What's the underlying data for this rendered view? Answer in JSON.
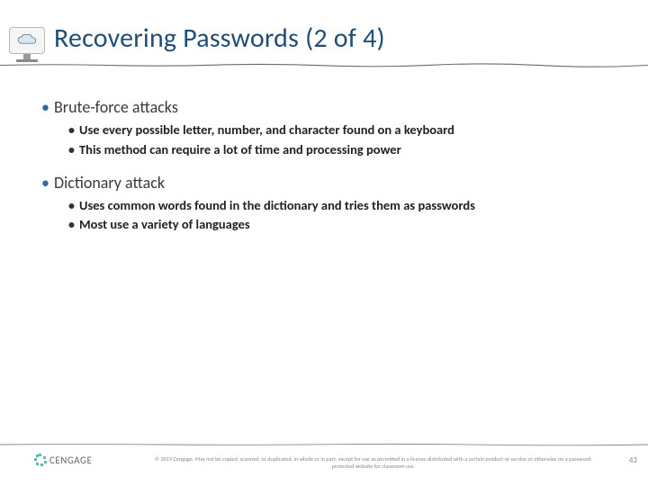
{
  "header": {
    "title": "Recovering Passwords (2 of 4)"
  },
  "bullets": [
    {
      "text": "Brute-force attacks",
      "subs": [
        "Use every possible letter, number, and character found on a keyboard",
        "This method can require a lot of time and processing power"
      ]
    },
    {
      "text": "Dictionary attack",
      "subs": [
        "Uses common words found in the dictionary and tries them as passwords",
        "Most use a variety of languages"
      ]
    }
  ],
  "footer": {
    "brand": "CENGAGE",
    "copyright": "© 2019 Cengage. May not be copied, scanned, or duplicated, in whole or in part, except for use as permitted in a license distributed with a certain product or service or otherwise on a password-protected website for classroom use.",
    "page": "43"
  }
}
